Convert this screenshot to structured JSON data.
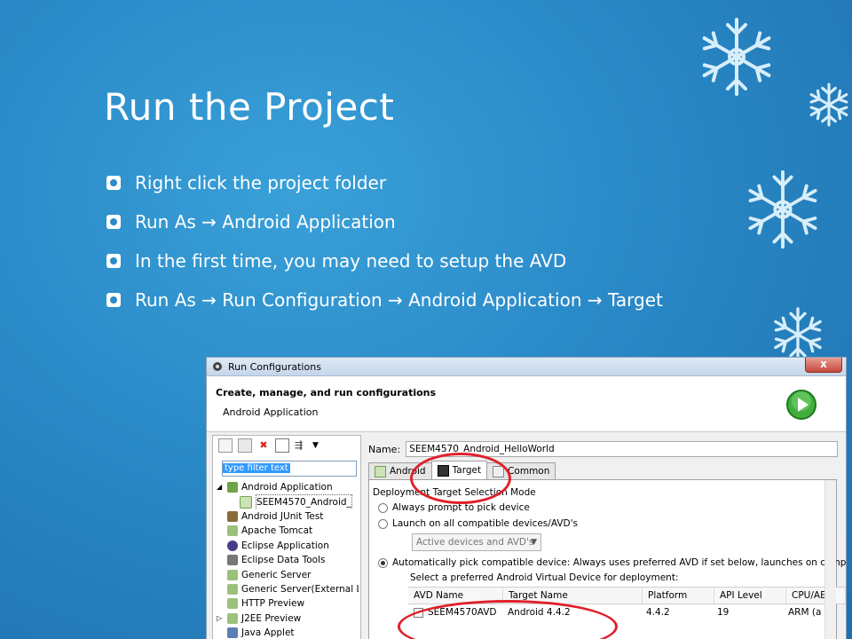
{
  "slide": {
    "title": "Run the Project",
    "bullets": [
      "Right click the project folder",
      "Run As → Android Application",
      "In the first time, you may need to setup the AVD",
      "Run As → Run Configuration → Android Application → Target"
    ],
    "colors": {
      "background": "#2a8bc8",
      "text": "#ffffff",
      "highlight": "#e0202a"
    }
  },
  "dialog": {
    "window_title": "Run Configurations",
    "close_label": "x",
    "header_title": "Create, manage, and run configurations",
    "header_subtitle": "Android Application",
    "filter_placeholder": "type filter text",
    "tree": [
      "Android Application",
      "SEEM4570_Android_",
      "Android JUnit Test",
      "Apache Tomcat",
      "Eclipse Application",
      "Eclipse Data Tools",
      "Generic Server",
      "Generic Server(External L",
      "HTTP Preview",
      "J2EE Preview",
      "Java Applet"
    ],
    "name_label": "Name:",
    "name_value": "SEEM4570_Android_HelloWorld",
    "tabs": [
      "Android",
      "Target",
      "Common"
    ],
    "group_label": "Deployment Target Selection Mode",
    "options": [
      "Always prompt to pick device",
      "Launch on all compatible devices/AVD's",
      "Automatically pick compatible device: Always uses preferred AVD if set below, launches on compati"
    ],
    "select_value": "Active devices and AVD's",
    "avd_prompt": "Select a preferred Android Virtual Device for deployment:",
    "table_headers": [
      "AVD Name",
      "Target Name",
      "Platform",
      "API Level",
      "CPU/AE"
    ],
    "table_rows": [
      [
        "SEEM4570AVD",
        "Android 4.4.2",
        "4.4.2",
        "19",
        "ARM (a"
      ]
    ]
  }
}
